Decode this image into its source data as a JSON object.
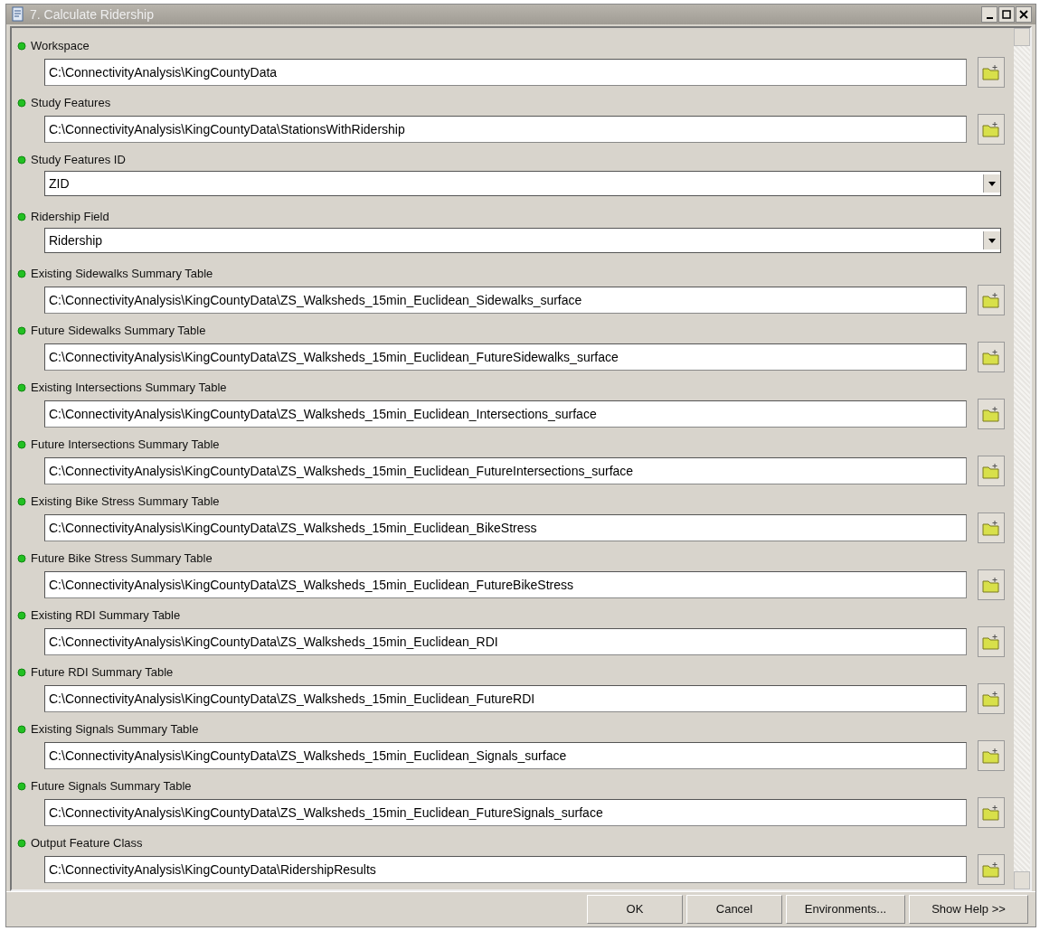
{
  "window": {
    "title": "7. Calculate Ridership"
  },
  "parameters": [
    {
      "label": "Workspace",
      "kind": "browse",
      "value": "C:\\ConnectivityAnalysis\\KingCountyData"
    },
    {
      "label": "Study Features",
      "kind": "browse",
      "value": "C:\\ConnectivityAnalysis\\KingCountyData\\StationsWithRidership"
    },
    {
      "label": "Study Features ID",
      "kind": "dropdown",
      "value": "ZID"
    },
    {
      "label": "Ridership Field",
      "kind": "dropdown",
      "value": "Ridership"
    },
    {
      "label": "Existing Sidewalks Summary Table",
      "kind": "browse",
      "value": "C:\\ConnectivityAnalysis\\KingCountyData\\ZS_Walksheds_15min_Euclidean_Sidewalks_surface"
    },
    {
      "label": "Future Sidewalks Summary Table",
      "kind": "browse",
      "value": "C:\\ConnectivityAnalysis\\KingCountyData\\ZS_Walksheds_15min_Euclidean_FutureSidewalks_surface"
    },
    {
      "label": "Existing Intersections Summary Table",
      "kind": "browse",
      "value": "C:\\ConnectivityAnalysis\\KingCountyData\\ZS_Walksheds_15min_Euclidean_Intersections_surface"
    },
    {
      "label": "Future Intersections Summary Table",
      "kind": "browse",
      "value": "C:\\ConnectivityAnalysis\\KingCountyData\\ZS_Walksheds_15min_Euclidean_FutureIntersections_surface"
    },
    {
      "label": "Existing Bike Stress Summary Table",
      "kind": "browse",
      "value": "C:\\ConnectivityAnalysis\\KingCountyData\\ZS_Walksheds_15min_Euclidean_BikeStress"
    },
    {
      "label": "Future Bike Stress Summary Table",
      "kind": "browse",
      "value": "C:\\ConnectivityAnalysis\\KingCountyData\\ZS_Walksheds_15min_Euclidean_FutureBikeStress"
    },
    {
      "label": "Existing RDI Summary Table",
      "kind": "browse",
      "value": "C:\\ConnectivityAnalysis\\KingCountyData\\ZS_Walksheds_15min_Euclidean_RDI"
    },
    {
      "label": "Future RDI Summary Table",
      "kind": "browse",
      "value": "C:\\ConnectivityAnalysis\\KingCountyData\\ZS_Walksheds_15min_Euclidean_FutureRDI"
    },
    {
      "label": "Existing Signals Summary Table",
      "kind": "browse",
      "value": "C:\\ConnectivityAnalysis\\KingCountyData\\ZS_Walksheds_15min_Euclidean_Signals_surface"
    },
    {
      "label": "Future Signals Summary Table",
      "kind": "browse",
      "value": "C:\\ConnectivityAnalysis\\KingCountyData\\ZS_Walksheds_15min_Euclidean_FutureSignals_surface"
    },
    {
      "label": "Output Feature Class",
      "kind": "browse",
      "value": "C:\\ConnectivityAnalysis\\KingCountyData\\RidershipResults"
    }
  ],
  "buttons": [
    "OK",
    "Cancel",
    "Environments...",
    "Show Help >>"
  ]
}
